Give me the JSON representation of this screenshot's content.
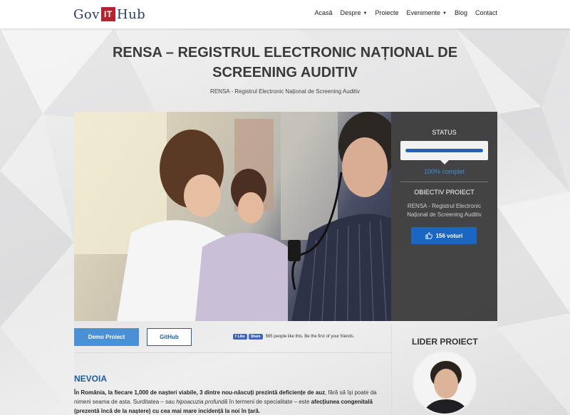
{
  "header": {
    "logo": {
      "left": "Gov",
      "mark": "IT",
      "right": "Hub"
    },
    "nav": [
      {
        "label": "Acasă",
        "dropdown": false
      },
      {
        "label": "Despre",
        "dropdown": true
      },
      {
        "label": "Proiecte",
        "dropdown": false
      },
      {
        "label": "Evenimente",
        "dropdown": true
      },
      {
        "label": "Blog",
        "dropdown": false
      },
      {
        "label": "Contact",
        "dropdown": false
      }
    ]
  },
  "page": {
    "title_line1": "RENSA – REGISTRUL ELECTRONIC NAȚIONAL DE",
    "title_line2": "SCREENING AUDITIV",
    "subtitle": "RENSA - Registrul Electronic Național de Screening Auditiv"
  },
  "status_panel": {
    "status_label": "STATUS",
    "progress": 100,
    "progress_text": "100% complet",
    "objective_label": "OBIECTIV PROIECT",
    "objective_text": "RENSA - Registrul Electronic Național de Screening Auditiv",
    "vote_label": "156 voturi",
    "vote_icon": "thumbs-up-icon"
  },
  "actions": {
    "demo_label": "Demo Proiect",
    "github_label": "GitHub",
    "fb_like": "Like",
    "fb_share": "Share",
    "fb_text": "565 people like this. Be the first of your friends."
  },
  "content": {
    "section_title": "NEVOIA",
    "para_1_bold": "În România, la fiecare 1,000 de nașteri viabile, 3 dintre nou-născuți prezintă deficiențe de auz",
    "para_1_rest": ", fără să își poate da nimeni seama de asta. Surditatea – sau ",
    "para_1_italic": "hipoacuzia profundă",
    "para_1_end": " în termeni de specialitate – este ",
    "para_2_bold": "afecțiunea congenitală (prezentă încă de la naștere) cu cea mai mare incidență la noi în țară."
  },
  "leader": {
    "title": "LIDER PROIECT"
  },
  "colors": {
    "brand_blue": "#1a66c2",
    "brand_red": "#b2242f",
    "link_blue": "#3c8fe0"
  }
}
